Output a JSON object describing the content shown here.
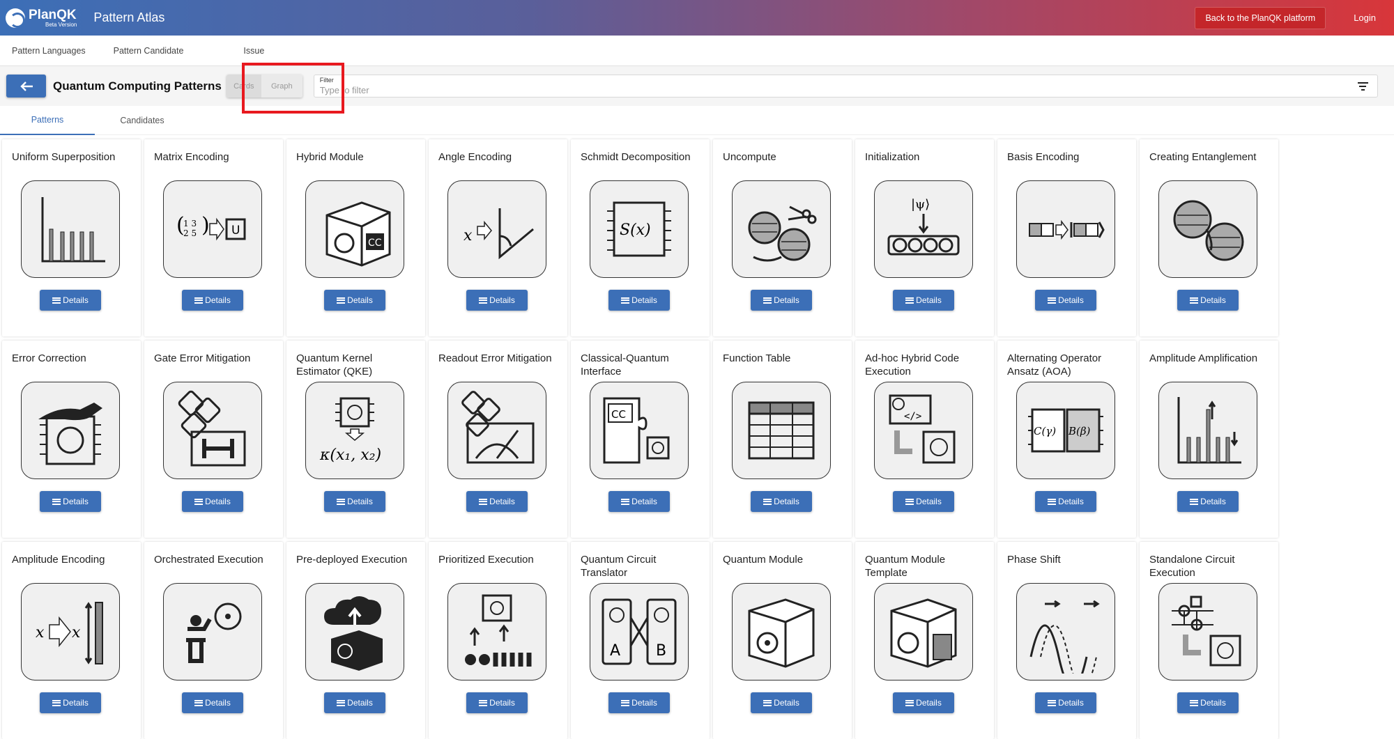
{
  "header": {
    "brand_name": "PlanQK",
    "brand_sub": "Beta Version",
    "app_title": "Pattern Atlas",
    "back_to_platform": "Back to the PlanQK platform",
    "login": "Login"
  },
  "nav": {
    "items": [
      {
        "label": "Pattern Languages"
      },
      {
        "label": "Pattern Candidate"
      },
      {
        "label": "Issue"
      }
    ]
  },
  "toolbar": {
    "title": "Quantum Computing Patterns",
    "view_cards": "Cards",
    "view_graph": "Graph",
    "filter_label": "Filter",
    "filter_placeholder": "Type to filter"
  },
  "subtabs": {
    "patterns": "Patterns",
    "candidates": "Candidates"
  },
  "details_label": "Details",
  "colors": {
    "primary": "#3c6fb7",
    "header_start": "#3c6fb7",
    "header_end": "#d8363a",
    "highlight": "#e8191f"
  },
  "patterns": [
    {
      "title": "Uniform Superposition",
      "icon": "bar-chart-icon"
    },
    {
      "title": "Matrix Encoding",
      "icon": "matrix-encoding-icon"
    },
    {
      "title": "Hybrid Module",
      "icon": "box-icon"
    },
    {
      "title": "Angle Encoding",
      "icon": "angle-icon"
    },
    {
      "title": "Schmidt Decomposition",
      "icon": "function-chip-icon"
    },
    {
      "title": "Uncompute",
      "icon": "yarn-scissors-icon"
    },
    {
      "title": "Initialization",
      "icon": "qubit-register-icon"
    },
    {
      "title": "Basis Encoding",
      "icon": "basis-encoding-icon"
    },
    {
      "title": "Creating Entanglement",
      "icon": "yarn-balls-icon"
    },
    {
      "title": "Error Correction",
      "icon": "wrench-chip-icon"
    },
    {
      "title": "Gate Error Mitigation",
      "icon": "dice-gate-icon"
    },
    {
      "title": "Quantum Kernel Estimator (QKE)",
      "icon": "kernel-icon"
    },
    {
      "title": "Readout Error Mitigation",
      "icon": "dice-meter-icon"
    },
    {
      "title": "Classical-Quantum Interface",
      "icon": "puzzle-icon"
    },
    {
      "title": "Function Table",
      "icon": "table-icon"
    },
    {
      "title": "Ad-hoc Hybrid Code Execution",
      "icon": "code-chip-icon"
    },
    {
      "title": "Alternating Operator Ansatz (AOA)",
      "icon": "aoa-icon"
    },
    {
      "title": "Amplitude Amplification",
      "icon": "amplification-icon"
    },
    {
      "title": "Amplitude Encoding",
      "icon": "amplitude-encoding-icon"
    },
    {
      "title": "Orchestrated Execution",
      "icon": "conductor-icon"
    },
    {
      "title": "Pre-deployed Execution",
      "icon": "cloud-box-icon"
    },
    {
      "title": "Prioritized Execution",
      "icon": "priority-icon"
    },
    {
      "title": "Quantum Circuit Translator",
      "icon": "translator-icon"
    },
    {
      "title": "Quantum Module",
      "icon": "box-atom-icon"
    },
    {
      "title": "Quantum Module Template",
      "icon": "box-puzzle-icon"
    },
    {
      "title": "Phase Shift",
      "icon": "wave-icon"
    },
    {
      "title": "Standalone Circuit Execution",
      "icon": "circuit-chip-icon"
    }
  ],
  "icon_texts": {
    "matrix_a": "1 3",
    "matrix_b": "2 5",
    "gate_u": "U",
    "angle_x": "x",
    "schmidt": "S(x)",
    "psi": "|ψ⟩",
    "cc": "CC",
    "kernel": "κ(x₁, x₂)",
    "aoa_c": "C(γ)",
    "aoa_b": "B(β)",
    "amp_x": "x",
    "translator_a": "A",
    "translator_b": "B"
  }
}
